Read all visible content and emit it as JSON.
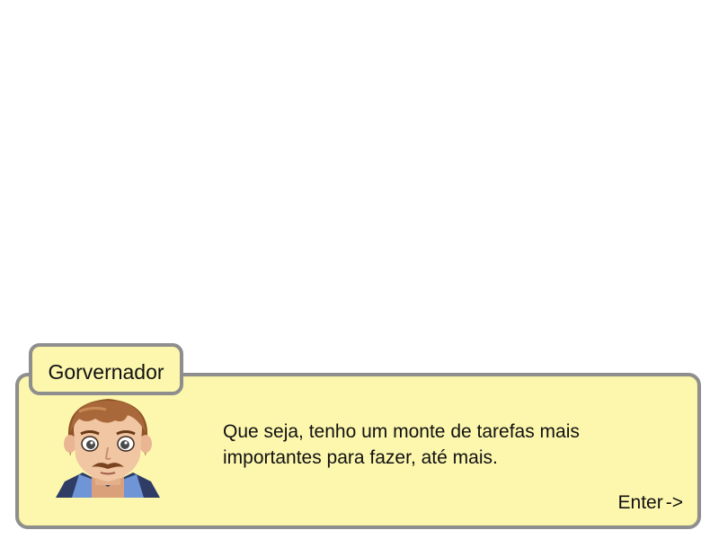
{
  "dialog": {
    "speaker": "Gorvernador",
    "lines": [
      "Que seja, tenho um monte de tarefas mais",
      "importantes para fazer, até mais."
    ],
    "continue_label": "Enter",
    "continue_arrow": "->"
  },
  "portrait": {
    "icon": "governor-face-portrait",
    "hair_color": "#a8683a",
    "skin_color": "#f1c6a3",
    "collar_color": "#6f95d6"
  },
  "colors": {
    "box_fill": "#fdf7ae",
    "box_border": "#8e8e8e",
    "text": "#111111"
  }
}
